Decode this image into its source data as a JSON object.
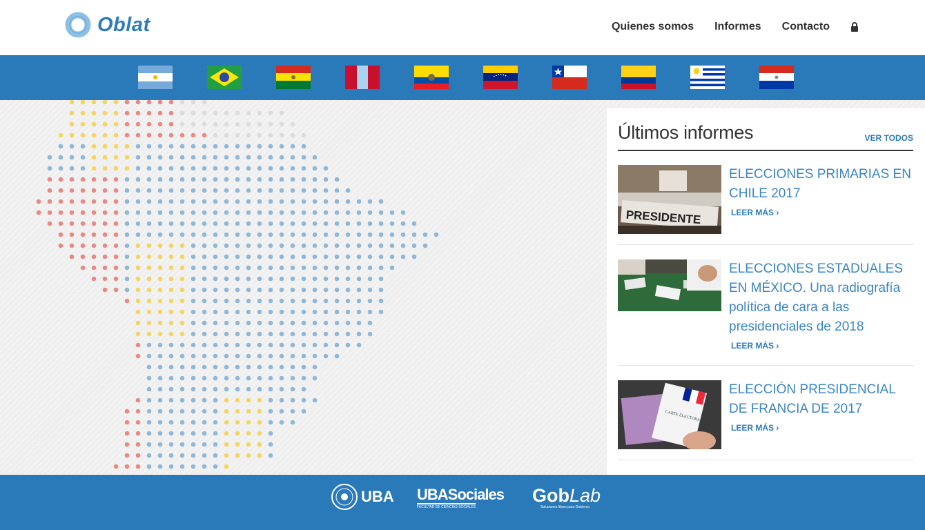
{
  "brand": {
    "name": "Oblat",
    "logo_icon": "ring-icon",
    "color": "#2d7cb8"
  },
  "nav": {
    "items": [
      "Quienes somos",
      "Informes",
      "Contacto"
    ],
    "lock_icon": "lock-icon"
  },
  "flags": [
    "Argentina",
    "Brasil",
    "Bolivia",
    "Perú",
    "Ecuador",
    "Venezuela",
    "Chile",
    "Colombia",
    "Uruguay",
    "Paraguay"
  ],
  "colors": {
    "accent": "#2a7ab9",
    "dot_blue": "#8fb8d8",
    "dot_red": "#e88a84",
    "dot_yellow": "#f5d562",
    "dot_gray": "#dcdcdc"
  },
  "sidebar": {
    "title": "Últimos informes",
    "see_all": "VER TODOS",
    "reports": [
      {
        "title": "ELECCIONES PRIMARIAS EN CHILE 2017",
        "more": "LEER MÁS ›",
        "image_label": "PRESIDENTE"
      },
      {
        "title": "ELECCIONES ESTADUALES EN MÉXICO. Una radiografía política de cara a las presidenciales de 2018",
        "more": "LEER MÁS ›"
      },
      {
        "title": "ELECCIÓN PRESIDENCIAL DE FRANCIA DE 2017",
        "more": "LEER MÁS ›",
        "image_label": "CARTE ÉLECTORALE"
      }
    ]
  },
  "footer": {
    "logos": [
      {
        "name": "UBA"
      },
      {
        "name": "UBASociales",
        "subtitle": "FACULTAD DE CIENCIAS SOCIALES"
      },
      {
        "name_part1": "Gob",
        "name_part2": "Lab",
        "subtitle": "Soluciones libres para Gobierno"
      }
    ]
  }
}
